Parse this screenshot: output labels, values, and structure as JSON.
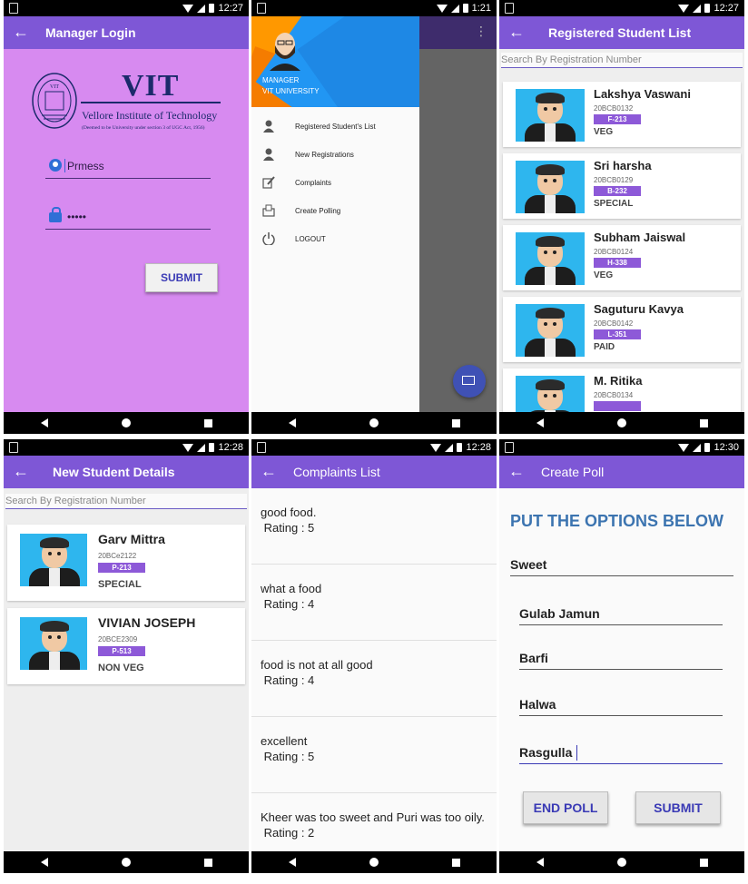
{
  "status": {
    "phone1_time": "12:27",
    "phone2_time": "1:21",
    "phone3_time": "12:27",
    "phone4_time": "12:28",
    "phone5_time": "12:28",
    "phone6_time": "12:30"
  },
  "login": {
    "title": "Manager Login",
    "logo_name": "VIT",
    "logo_full": "Vellore Institute of Technology",
    "logo_small": "(Deemed to be University under section 3 of UGC Act, 1956)",
    "username_value": "Prmess",
    "password_value": "•••••",
    "submit_label": "SUBMIT"
  },
  "drawer": {
    "role": "MANAGER",
    "org": "VIT UNIVERSITY",
    "items": [
      {
        "label": "Registered Student's List",
        "icon": "person-icon"
      },
      {
        "label": "New Registrations",
        "icon": "person-icon"
      },
      {
        "label": "Complaints",
        "icon": "pen-icon"
      },
      {
        "label": "Create Polling",
        "icon": "vote-icon"
      },
      {
        "label": "LOGOUT",
        "icon": "power-icon"
      }
    ]
  },
  "registered": {
    "title": "Registered Student List",
    "search_placeholder": "Search By Registration Number",
    "students": [
      {
        "name": "Lakshya Vaswani",
        "reg": "20BCB0132",
        "room": "F-213",
        "meal": "VEG"
      },
      {
        "name": "Sri harsha",
        "reg": "20BCB0129",
        "room": "B-232",
        "meal": "SPECIAL"
      },
      {
        "name": "Subham Jaiswal",
        "reg": "20BCB0124",
        "room": "H-338",
        "meal": "VEG"
      },
      {
        "name": "Saguturu Kavya",
        "reg": "20BCB0142",
        "room": "L-351",
        "meal": "PAID"
      },
      {
        "name": "M. Ritika",
        "reg": "20BCB0134",
        "room": "",
        "meal": ""
      }
    ]
  },
  "new_students": {
    "title": "New Student Details",
    "search_placeholder": "Search By Registration Number",
    "students": [
      {
        "name": "Garv Mittra",
        "reg": "20BCe2122",
        "room": "P-213",
        "meal": "SPECIAL"
      },
      {
        "name": "VIVIAN JOSEPH",
        "reg": "20BCE2309",
        "room": "P-513",
        "meal": "NON VEG"
      }
    ]
  },
  "complaints": {
    "title": "Complaints List",
    "items": [
      {
        "text": "good food.",
        "rating": "Rating : 5"
      },
      {
        "text": "what a food",
        "rating": "Rating : 4"
      },
      {
        "text": "food is not at all good",
        "rating": "Rating : 4"
      },
      {
        "text": "excellent",
        "rating": "Rating : 5"
      },
      {
        "text": "Kheer was too sweet and Puri was too oily.",
        "rating": "Rating : 2"
      }
    ]
  },
  "poll": {
    "title": "Create Poll",
    "heading": "PUT THE OPTIONS BELOW",
    "question": "Sweet",
    "options": [
      "Gulab Jamun",
      "Barfi",
      "Halwa",
      "Rasgulla"
    ],
    "end_label": "END POLL",
    "submit_label": "SUBMIT"
  },
  "colors": {
    "appbar": "#7e57d6",
    "login_bg": "#d78af0",
    "badge": "#8d59d8",
    "heading": "#3c74b0"
  }
}
